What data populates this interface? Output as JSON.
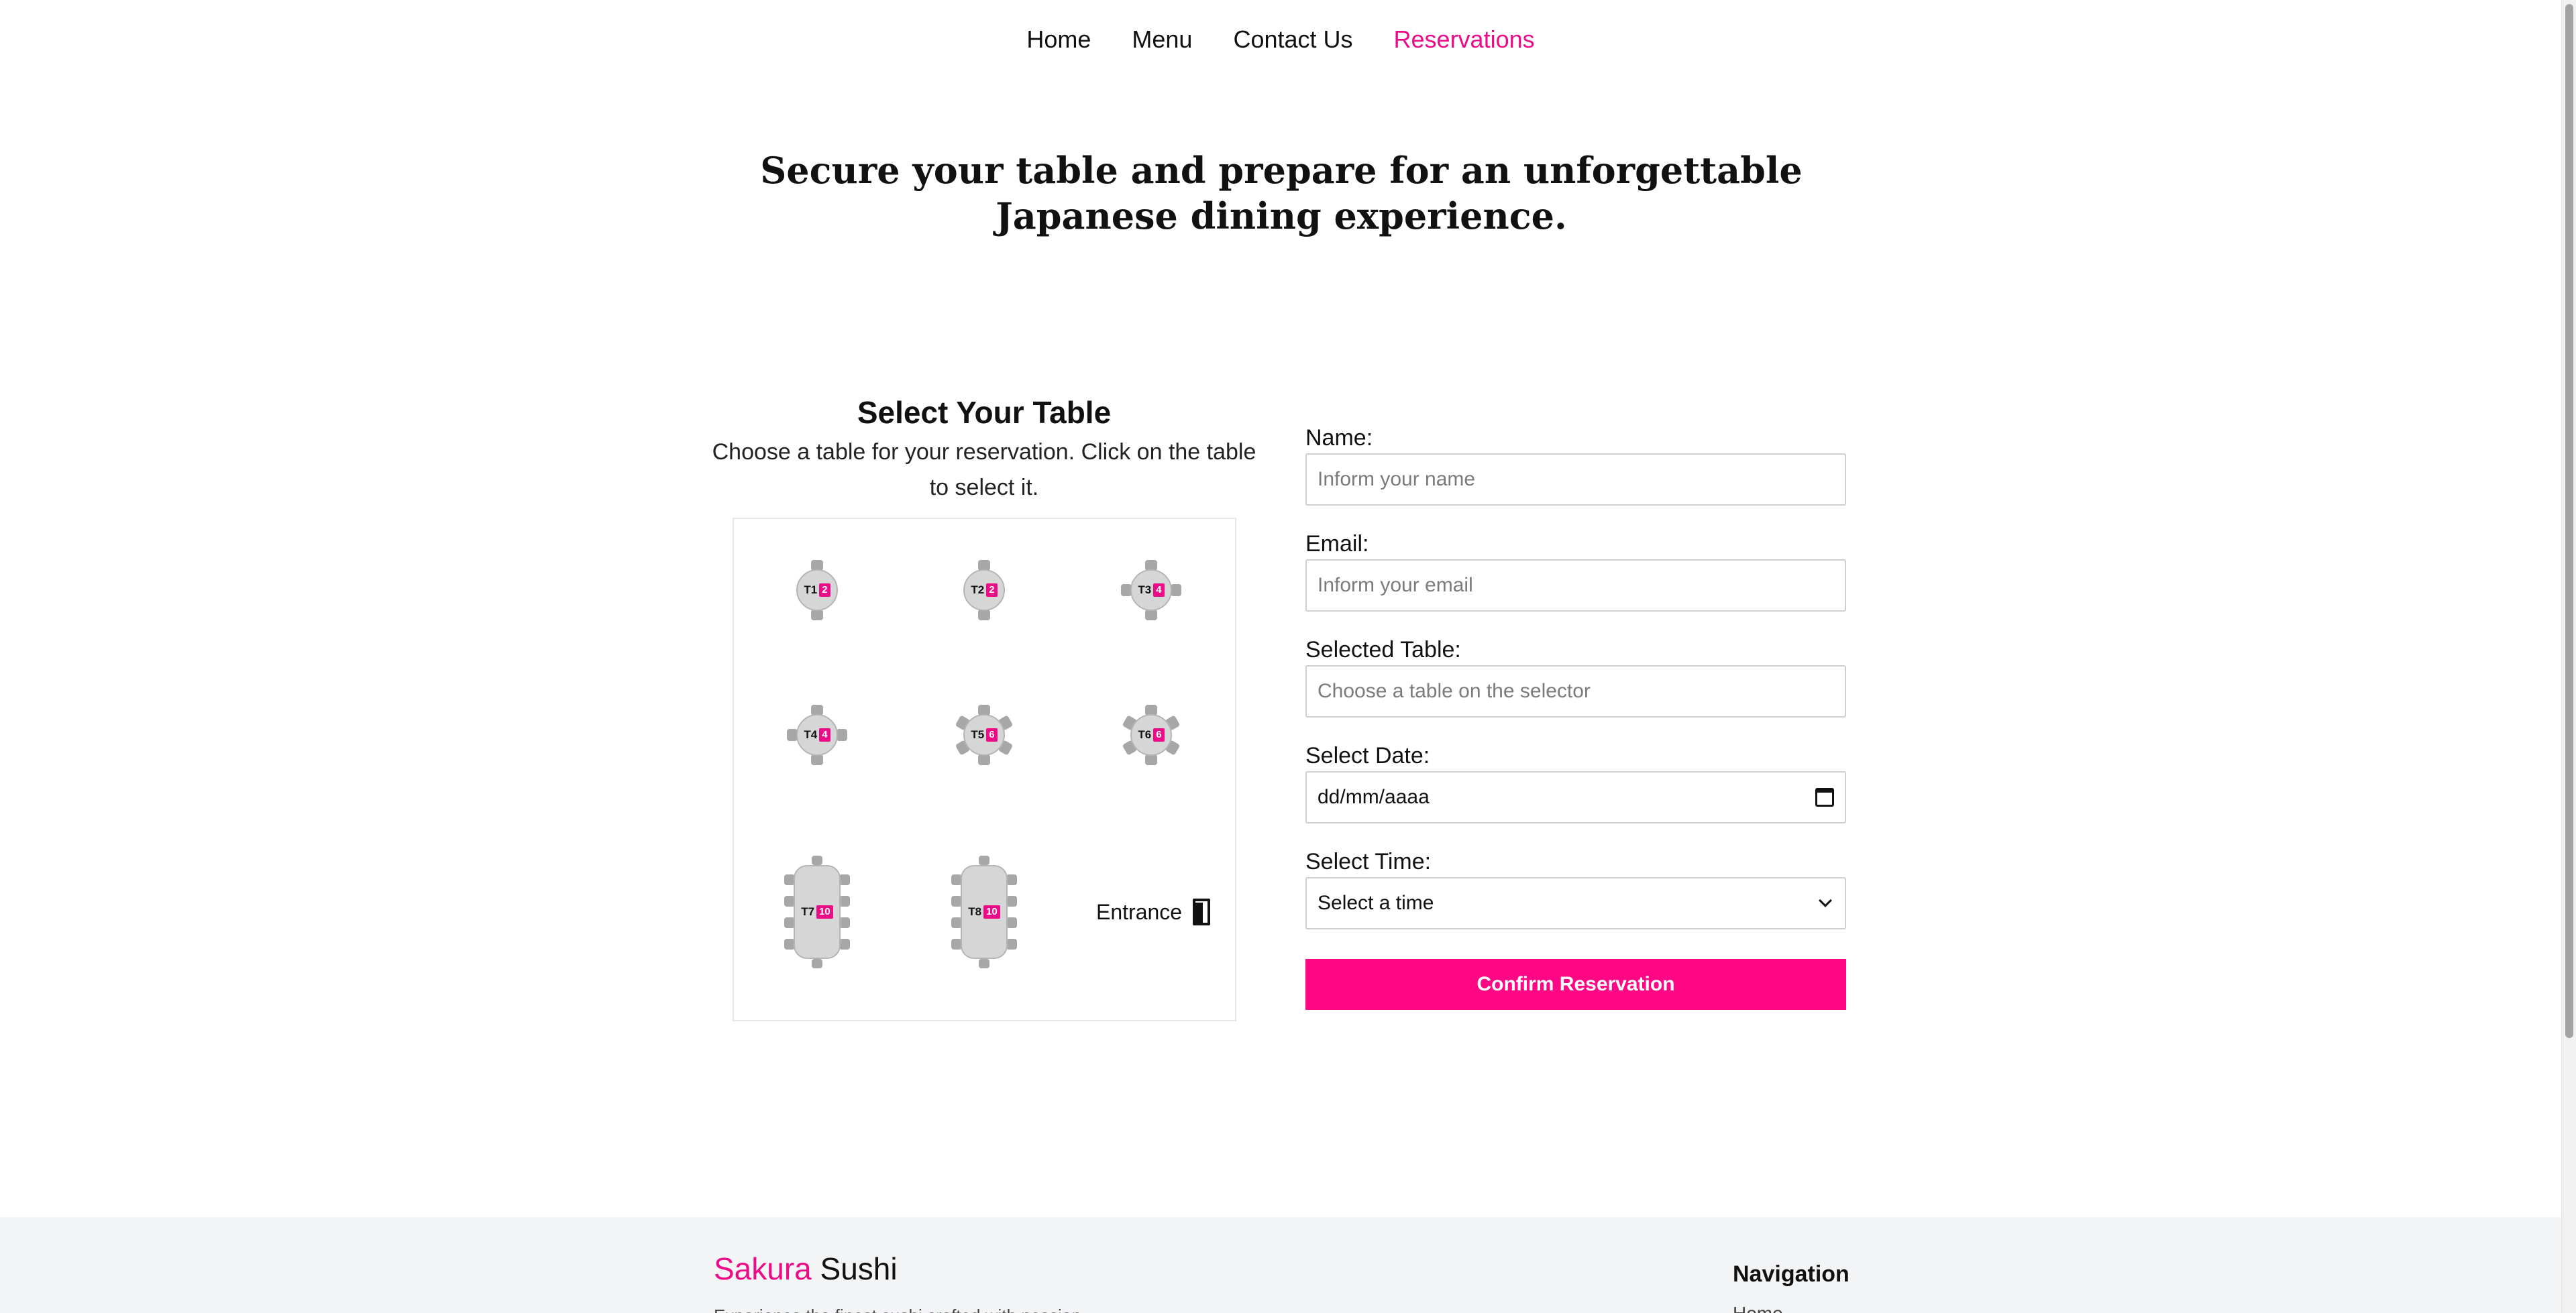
{
  "nav": {
    "items": [
      "Home",
      "Menu",
      "Contact Us",
      "Reservations"
    ],
    "active": "Reservations"
  },
  "hero": {
    "title": "Secure your table and prepare for an unforgettable Japanese dining experience."
  },
  "selector": {
    "title": "Select Your Table",
    "description": "Choose a table for your reservation. Click on the table to select it.",
    "tables": [
      {
        "label": "T1",
        "seats": "2"
      },
      {
        "label": "T2",
        "seats": "2"
      },
      {
        "label": "T3",
        "seats": "4"
      },
      {
        "label": "T4",
        "seats": "4"
      },
      {
        "label": "T5",
        "seats": "6"
      },
      {
        "label": "T6",
        "seats": "6"
      },
      {
        "label": "T7",
        "seats": "10"
      },
      {
        "label": "T8",
        "seats": "10"
      }
    ],
    "entrance": "Entrance"
  },
  "form": {
    "name_label": "Name:",
    "name_placeholder": "Inform your name",
    "email_label": "Email:",
    "email_placeholder": "Inform your email",
    "table_label": "Selected Table:",
    "table_placeholder": "Choose a table on the selector",
    "date_label": "Select Date:",
    "date_value": "dd/mm/aaaa",
    "time_label": "Select Time:",
    "time_value": "Select a time",
    "confirm_label": "Confirm Reservation"
  },
  "footer": {
    "brand_accent": "Sakura",
    "brand_rest": "Sushi",
    "tagline": "Experience the finest sushi crafted with passion",
    "nav_heading": "Navigation",
    "nav_first": "Home"
  },
  "colors": {
    "accent": "#ec0c88",
    "button": "#ff0784",
    "footer_bg": "#f3f4f6"
  }
}
